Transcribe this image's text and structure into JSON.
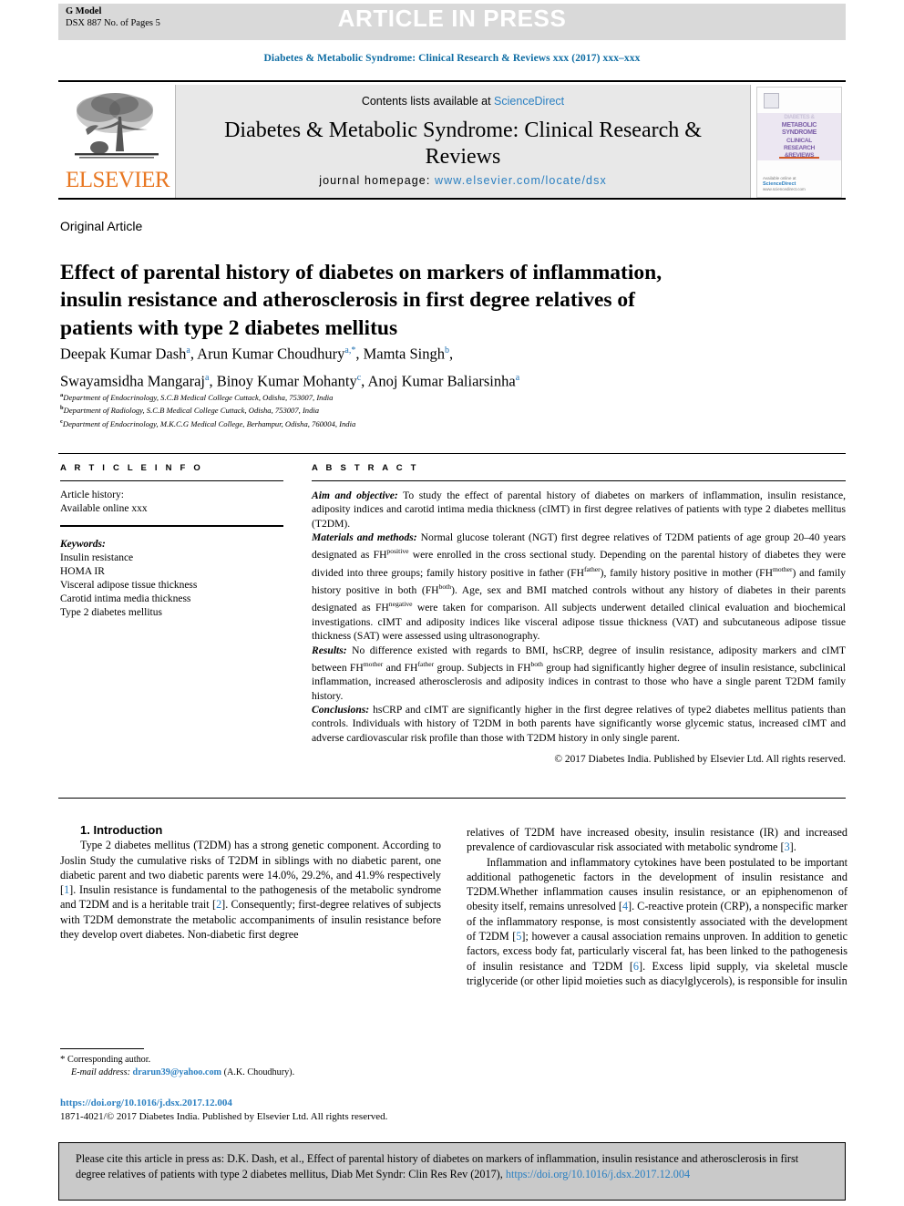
{
  "header": {
    "g_model_line1": "G Model",
    "g_model_line2": "DSX 887 No. of Pages 5",
    "article_in_press": "ARTICLE IN PRESS",
    "running_head": "Diabetes & Metabolic Syndrome: Clinical Research & Reviews xxx (2017) xxx–xxx"
  },
  "masthead": {
    "contents_prefix": "Contents lists available at ",
    "sciencedirect": "ScienceDirect",
    "journal_name": "Diabetes & Metabolic Syndrome: Clinical Research & Reviews",
    "homepage_label": "journal homepage: ",
    "homepage_url": "www.elsevier.com/locate/dsx",
    "publisher": "ELSEVIER",
    "cover": {
      "line1": "DIABETES &",
      "line2": "METABOLIC",
      "line3": "SYNDROME",
      "line4": "CLINICAL",
      "line5": "RESEARCH",
      "line6": "&REVIEWS",
      "foot_label": "Available online at",
      "foot_brand": "ScienceDirect",
      "foot_url": "www.sciencedirect.com"
    }
  },
  "article": {
    "type": "Original Article",
    "title": "Effect of parental history of diabetes on markers of inflammation, insulin resistance and atherosclerosis in first degree relatives of patients with type 2 diabetes mellitus",
    "authors_line1": "Deepak Kumar Dash",
    "authors": [
      {
        "name": "Deepak Kumar Dash",
        "sup": "a"
      },
      {
        "name": "Arun Kumar Choudhury",
        "sup": "a,*"
      },
      {
        "name": "Mamta Singh",
        "sup": "b"
      },
      {
        "name": "Swayamsidha Mangaraj",
        "sup": "a"
      },
      {
        "name": "Binoy Kumar Mohanty",
        "sup": "c"
      },
      {
        "name": "Anoj Kumar Baliarsinha",
        "sup": "a"
      }
    ],
    "affiliations": [
      {
        "mark": "a",
        "text": "Department of Endocrinology, S.C.B Medical College Cuttack, Odisha, 753007, India"
      },
      {
        "mark": "b",
        "text": "Department of Radiology, S.C.B Medical College Cuttack, Odisha, 753007, India"
      },
      {
        "mark": "c",
        "text": "Department of Endocrinology, M.K.C.G Medical College, Berhampur, Odisha, 760004, India"
      }
    ]
  },
  "article_info": {
    "label": "A R T I C L E   I N F O",
    "history_title": "Article history:",
    "history_line": "Available online xxx",
    "keywords_title": "Keywords:",
    "keywords": [
      "Insulin resistance",
      "HOMA IR",
      "Visceral adipose tissue thickness",
      "Carotid intima media thickness",
      "Type 2 diabetes mellitus"
    ]
  },
  "abstract": {
    "label": "A B S T R A C T",
    "sections": [
      {
        "lead": "Aim and objective:",
        "text": " To study the effect of parental history of diabetes on markers of inflammation, insulin resistance, adiposity indices and carotid intima media thickness (cIMT) in first degree relatives of patients with type 2 diabetes mellitus (T2DM)."
      },
      {
        "lead": "Materials and methods:",
        "text": " Normal glucose tolerant (NGT) first degree relatives of T2DM patients of age group 20–40 years designated as FH<sup>positive</sup> were enrolled in the cross sectional study. Depending on the parental history of diabetes they were divided into three groups; family history positive in father (FH<sup>father</sup>), family history positive in mother (FH<sup>mother</sup>) and family history positive in both (FH<sup>both</sup>). Age, sex and BMI matched controls without any history of diabetes in their parents designated as FH<sup>negative</sup> were taken for comparison. All subjects underwent detailed clinical evaluation and biochemical investigations. cIMT and adiposity indices like visceral adipose tissue thickness (VAT) and subcutaneous adipose tissue thickness (SAT) were assessed using ultrasonography."
      },
      {
        "lead": "Results:",
        "text": " No difference existed with regards to BMI, hsCRP, degree of insulin resistance, adiposity markers and cIMT between FH<sup>mother</sup> and FH<sup>father</sup> group. Subjects in FH<sup>both</sup> group had significantly higher degree of insulin resistance, subclinical inflammation, increased atherosclerosis and adiposity indices in contrast to those who have a single parent T2DM family history."
      },
      {
        "lead": "Conclusions:",
        "text": " hsCRP and cIMT are significantly higher in the first degree relatives of type2 diabetes mellitus patients than controls. Individuals with history of T2DM in both parents have significantly worse glycemic status, increased cIMT and adverse cardiovascular risk profile than those with T2DM history in only single parent."
      }
    ],
    "copyright": "© 2017 Diabetes India. Published by Elsevier Ltd. All rights reserved."
  },
  "body": {
    "section_heading": "1. Introduction",
    "left_paragraphs": [
      "Type 2 diabetes mellitus (T2DM) has a strong genetic component. According to Joslin Study the cumulative risks of T2DM in siblings with no diabetic parent, one diabetic parent and two diabetic parents were 14.0%, 29.2%, and 41.9% respectively [1]. Insulin resistance is fundamental to the pathogenesis of the metabolic syndrome and T2DM and is a heritable trait [2]. Consequently; first-degree relatives of subjects with T2DM demonstrate the metabolic accompaniments of insulin resistance before they develop overt diabetes. Non-diabetic first degree"
    ],
    "right_paragraphs": [
      "relatives of T2DM have increased obesity, insulin resistance (IR) and increased prevalence of cardiovascular risk associated with metabolic syndrome [3].",
      "Inflammation and inflammatory cytokines have been postulated to be important additional pathogenetic factors in the development of insulin resistance and T2DM.Whether inflammation causes insulin resistance, or an epiphenomenon of obesity itself, remains unresolved [4]. C-reactive protein (CRP), a nonspecific marker of the inflammatory response, is most consistently associated with the development of T2DM [5]; however a causal association remains unproven. In addition to genetic factors, excess body fat, particularly visceral fat, has been linked to the pathogenesis of insulin resistance and T2DM [6]. Excess lipid supply, via skeletal muscle triglyceride (or other lipid moieties such as diacylglycerols), is responsible for insulin"
    ]
  },
  "footnote": {
    "corresponding": "Corresponding author.",
    "email_label": "E-mail address:",
    "email": "drarun39@yahoo.com",
    "email_suffix": " (A.K. Choudhury).",
    "doi": "https://doi.org/10.1016/j.dsx.2017.12.004",
    "issn_line": "1871-4021/© 2017 Diabetes India. Published by Elsevier Ltd. All rights reserved."
  },
  "cite_box": {
    "text_before": "Please cite this article in press as: D.K. Dash, et al., Effect of parental history of diabetes on markers of inflammation, insulin resistance and atherosclerosis in first degree relatives of patients with type 2 diabetes mellitus, Diab Met Syndr: Clin Res Rev (2017), ",
    "link": "https://doi.org/10.1016/j.dsx.2017.12.004"
  },
  "colors": {
    "link_blue": "#2a7fc1",
    "head_blue": "#0d6ca3",
    "elsevier_orange": "#e87722",
    "band_grey": "#d9d9d9",
    "mast_grey": "#e8e8e8",
    "cite_grey": "#c9c9c9"
  }
}
